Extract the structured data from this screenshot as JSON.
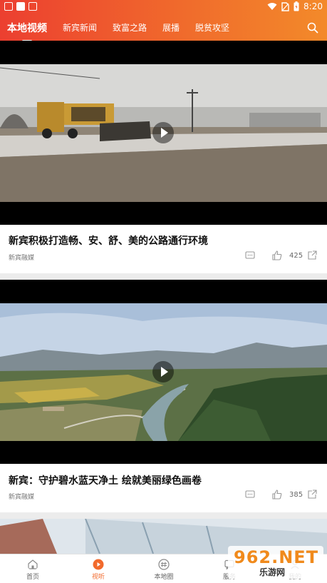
{
  "status_bar": {
    "time": "8:20"
  },
  "tabs": [
    {
      "label": "本地视频",
      "active": true
    },
    {
      "label": "新宾新闻",
      "active": false
    },
    {
      "label": "致富之路",
      "active": false
    },
    {
      "label": "展播",
      "active": false
    },
    {
      "label": "脱贫攻坚",
      "active": false
    }
  ],
  "articles": [
    {
      "title": "新宾积极打造畅、安、舒、美的公路通行环境",
      "source": "新宾融媒",
      "likes": "425"
    },
    {
      "title": "新宾：守护碧水蓝天净土  绘就美丽绿色画卷",
      "source": "新宾融媒",
      "likes": "385"
    }
  ],
  "bottom_nav": [
    {
      "label": "首页",
      "icon": "home-icon"
    },
    {
      "label": "视听",
      "icon": "play-circle-icon",
      "active": true
    },
    {
      "label": "本地圈",
      "icon": "hash-circle-icon"
    },
    {
      "label": "服务",
      "icon": "chat-icon"
    },
    {
      "label": "我的",
      "icon": "user-icon"
    }
  ],
  "watermark": {
    "line1": "962.NET",
    "line2": "乐游网"
  },
  "colors": {
    "accent": "#f26a2c",
    "header_start": "#ec3f30",
    "header_end": "#f38a2a"
  }
}
